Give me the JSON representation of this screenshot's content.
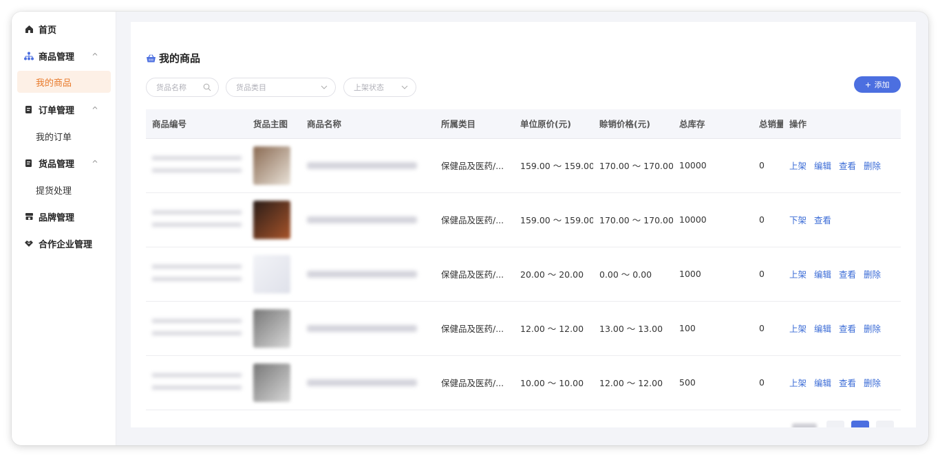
{
  "sidebar": {
    "items": [
      {
        "label": "首页",
        "icon": "home-icon"
      },
      {
        "label": "商品管理",
        "icon": "sitemap-icon",
        "children": [
          "我的商品"
        ]
      },
      {
        "label": "订单管理",
        "icon": "order-icon",
        "children": [
          "我的订单"
        ]
      },
      {
        "label": "货品管理",
        "icon": "goods-icon",
        "children": [
          "提货处理"
        ]
      },
      {
        "label": "品牌管理",
        "icon": "brand-icon"
      },
      {
        "label": "合作企业管理",
        "icon": "handshake-icon"
      }
    ],
    "active": "我的商品"
  },
  "page": {
    "title": "我的商品",
    "title_icon": "basket-icon",
    "filters": {
      "name_placeholder": "货品名称",
      "category_placeholder": "货品类目",
      "status_placeholder": "上架状态"
    },
    "add_label": "添加"
  },
  "table": {
    "columns": [
      "商品编号",
      "货品主图",
      "商品名称",
      "所属类目",
      "单位原价(元)",
      "赊销价格(元)",
      "总库存",
      "总销量",
      "操作"
    ],
    "rows": [
      {
        "category": "保健品及医药/...",
        "orig_price": "159.00 ～ 159.00",
        "credit_price": "170.00 ～ 170.00",
        "stock": "10000",
        "sales": "0",
        "ops": [
          "上架",
          "编辑",
          "查看",
          "删除"
        ],
        "thumb_colors": [
          "#8a6a52",
          "#e9e2d8"
        ]
      },
      {
        "category": "保健品及医药/...",
        "orig_price": "159.00 ～ 159.00",
        "credit_price": "170.00 ～ 170.00",
        "stock": "10000",
        "sales": "0",
        "ops": [
          "下架",
          "查看"
        ],
        "thumb_colors": [
          "#2a1d18",
          "#a8542a"
        ]
      },
      {
        "category": "保健品及医药/...",
        "orig_price": "20.00 ～ 20.00",
        "credit_price": "0.00 ～ 0.00",
        "stock": "1000",
        "sales": "0",
        "ops": [
          "上架",
          "编辑",
          "查看",
          "删除"
        ],
        "thumb_colors": [
          "#f2f3f7",
          "#dfe1ea"
        ]
      },
      {
        "category": "保健品及医药/...",
        "orig_price": "12.00 ～ 12.00",
        "credit_price": "13.00 ～ 13.00",
        "stock": "100",
        "sales": "0",
        "ops": [
          "上架",
          "编辑",
          "查看",
          "删除"
        ],
        "thumb_colors": [
          "#777777",
          "#d8d8d8"
        ]
      },
      {
        "category": "保健品及医药/...",
        "orig_price": "10.00 ～ 10.00",
        "credit_price": "12.00 ～ 12.00",
        "stock": "500",
        "sales": "0",
        "ops": [
          "上架",
          "编辑",
          "查看",
          "删除"
        ],
        "thumb_colors": [
          "#777777",
          "#d8d8d8"
        ]
      }
    ]
  },
  "colors": {
    "accent": "#4c6fe0",
    "link": "#3a6bd6",
    "active_menu_text": "#e8792a",
    "active_menu_bg": "#fdf0e6"
  }
}
